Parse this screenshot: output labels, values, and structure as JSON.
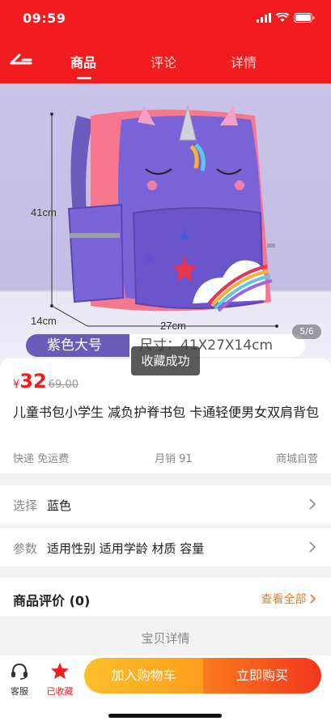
{
  "status": {
    "time": "09:59"
  },
  "tabs": [
    {
      "label": "商品"
    },
    {
      "label": "评论"
    },
    {
      "label": "详情"
    }
  ],
  "image": {
    "dims": {
      "height": "41cm",
      "width": "27cm",
      "depth": "14cm"
    },
    "spec_color": "紫色大号",
    "spec_size": "尺寸：41X27X14cm",
    "page": "5/6"
  },
  "toast": "收藏成功",
  "product": {
    "currency": "¥",
    "price": "32",
    "old_price": "69.00",
    "title": "儿童书包小学生 减负护脊书包 卡通轻便男女双肩背包",
    "shipping": "快递 免运费",
    "monthly_sales": "月销 91",
    "store": "商城自营"
  },
  "select_row": {
    "label": "选择",
    "value": "蓝色"
  },
  "params_row": {
    "label": "参数",
    "value": "适用性别 适用学龄 材质 容量"
  },
  "review": {
    "title": "商品评价 (0)",
    "view_all": "查看全部"
  },
  "detail_title": "宝贝详情",
  "bottom": {
    "service": "客服",
    "collected": "已收藏",
    "add_cart": "加入购物车",
    "buy_now": "立即购买"
  },
  "colors": {
    "brand_red": "#f01c1f",
    "accent_orange": "#f07a1a"
  }
}
